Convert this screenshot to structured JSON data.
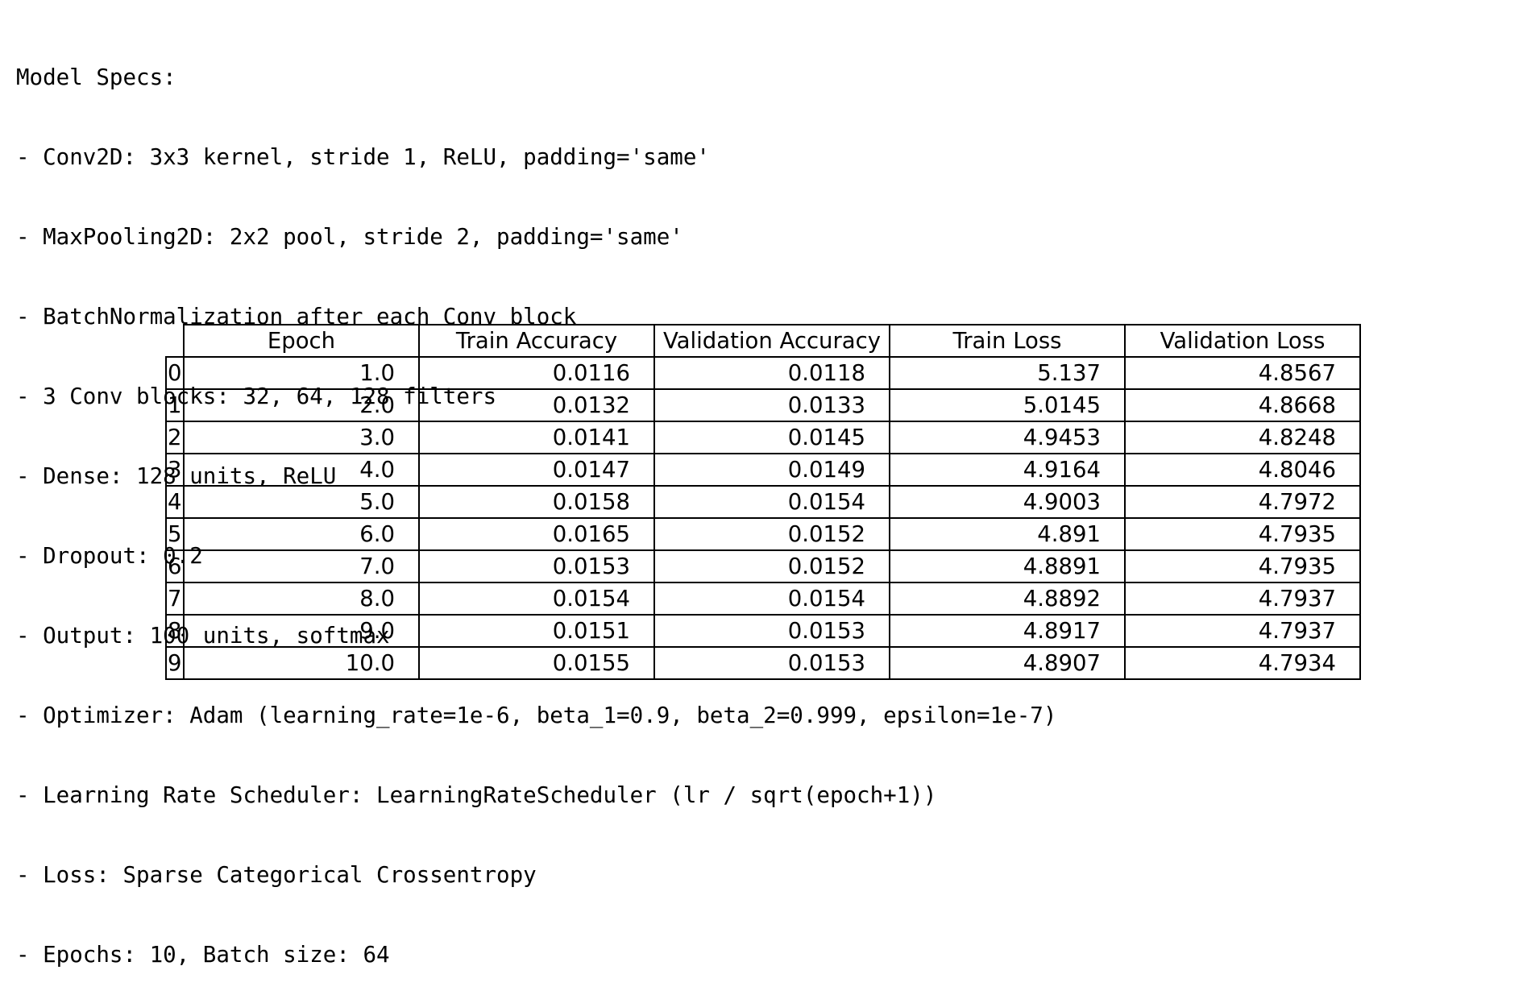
{
  "specs": {
    "lines": [
      "Model Specs:",
      "- Conv2D: 3x3 kernel, stride 1, ReLU, padding='same'",
      "- MaxPooling2D: 2x2 pool, stride 2, padding='same'",
      "- BatchNormalization after each Conv block",
      "- 3 Conv blocks: 32, 64, 128 filters",
      "- Dense: 128 units, ReLU",
      "- Dropout: 0.2",
      "- Output: 100 units, softmax",
      "- Optimizer: Adam (learning_rate=1e-6, beta_1=0.9, beta_2=0.999, epsilon=1e-7)",
      "- Learning Rate Scheduler: LearningRateScheduler (lr / sqrt(epoch+1))",
      "- Loss: Sparse Categorical Crossentropy",
      "- Epochs: 10, Batch size: 64"
    ]
  },
  "table": {
    "columns": [
      "Epoch",
      "Train Accuracy",
      "Validation Accuracy",
      "Train Loss",
      "Validation Loss"
    ],
    "rows": [
      {
        "index": "0",
        "cells": [
          "1.0",
          "0.0116",
          "0.0118",
          "5.137",
          "4.8567"
        ]
      },
      {
        "index": "1",
        "cells": [
          "2.0",
          "0.0132",
          "0.0133",
          "5.0145",
          "4.8668"
        ]
      },
      {
        "index": "2",
        "cells": [
          "3.0",
          "0.0141",
          "0.0145",
          "4.9453",
          "4.8248"
        ]
      },
      {
        "index": "3",
        "cells": [
          "4.0",
          "0.0147",
          "0.0149",
          "4.9164",
          "4.8046"
        ]
      },
      {
        "index": "4",
        "cells": [
          "5.0",
          "0.0158",
          "0.0154",
          "4.9003",
          "4.7972"
        ]
      },
      {
        "index": "5",
        "cells": [
          "6.0",
          "0.0165",
          "0.0152",
          "4.891",
          "4.7935"
        ]
      },
      {
        "index": "6",
        "cells": [
          "7.0",
          "0.0153",
          "0.0152",
          "4.8891",
          "4.7935"
        ]
      },
      {
        "index": "7",
        "cells": [
          "8.0",
          "0.0154",
          "0.0154",
          "4.8892",
          "4.7937"
        ]
      },
      {
        "index": "8",
        "cells": [
          "9.0",
          "0.0151",
          "0.0153",
          "4.8917",
          "4.7937"
        ]
      },
      {
        "index": "9",
        "cells": [
          "10.0",
          "0.0155",
          "0.0153",
          "4.8907",
          "4.7934"
        ]
      }
    ]
  }
}
